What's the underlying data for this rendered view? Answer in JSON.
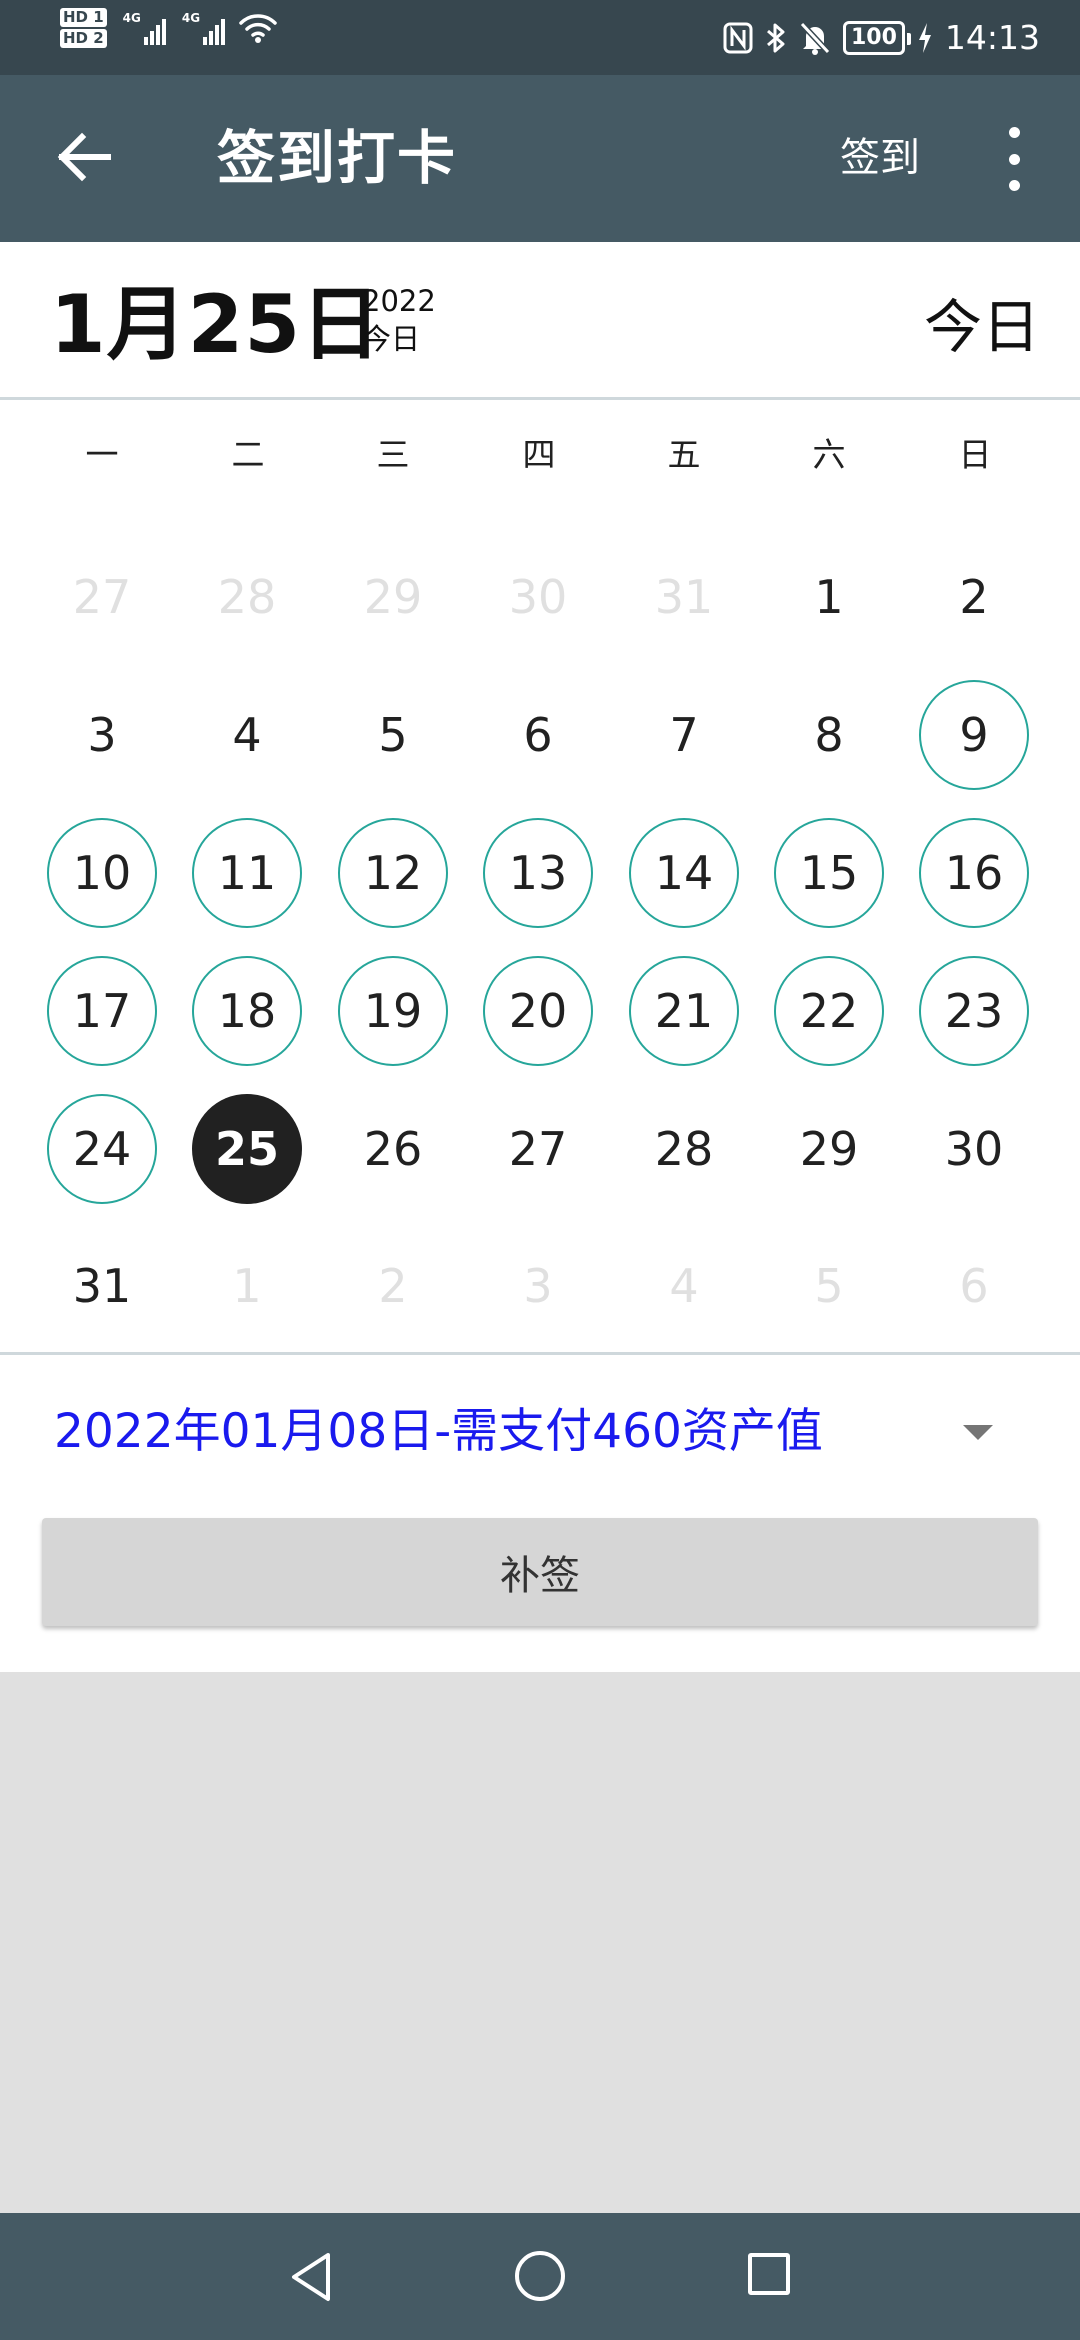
{
  "status_bar": {
    "time": "14:13",
    "battery": "100",
    "sim1_label": "HD 1",
    "sim2_label": "HD 2",
    "signal1_label": "4G",
    "signal2_label": "4G",
    "icons": [
      "nfc-icon",
      "bluetooth-icon",
      "mute-icon",
      "battery-icon",
      "charging-icon",
      "wifi-icon"
    ]
  },
  "app_bar": {
    "back_icon": "arrow-left-icon",
    "title": "签到打卡",
    "action_label": "签到",
    "more_icon": "more-vert-icon"
  },
  "date_header": {
    "selected_date": "1月25日",
    "year": "2022",
    "today_label": "今日",
    "today_button": "今日"
  },
  "weekdays": [
    "一",
    "二",
    "三",
    "四",
    "五",
    "六",
    "日"
  ],
  "calendar": {
    "weeks": [
      [
        {
          "n": "27",
          "s": "other"
        },
        {
          "n": "28",
          "s": "other"
        },
        {
          "n": "29",
          "s": "other"
        },
        {
          "n": "30",
          "s": "other"
        },
        {
          "n": "31",
          "s": "other"
        },
        {
          "n": "1",
          "s": "normal"
        },
        {
          "n": "2",
          "s": "normal"
        }
      ],
      [
        {
          "n": "3",
          "s": "normal"
        },
        {
          "n": "4",
          "s": "normal"
        },
        {
          "n": "5",
          "s": "normal"
        },
        {
          "n": "6",
          "s": "normal"
        },
        {
          "n": "7",
          "s": "normal"
        },
        {
          "n": "8",
          "s": "normal"
        },
        {
          "n": "9",
          "s": "signed"
        }
      ],
      [
        {
          "n": "10",
          "s": "signed"
        },
        {
          "n": "11",
          "s": "signed"
        },
        {
          "n": "12",
          "s": "signed"
        },
        {
          "n": "13",
          "s": "signed"
        },
        {
          "n": "14",
          "s": "signed"
        },
        {
          "n": "15",
          "s": "signed"
        },
        {
          "n": "16",
          "s": "signed"
        }
      ],
      [
        {
          "n": "17",
          "s": "signed"
        },
        {
          "n": "18",
          "s": "signed"
        },
        {
          "n": "19",
          "s": "signed"
        },
        {
          "n": "20",
          "s": "signed"
        },
        {
          "n": "21",
          "s": "signed"
        },
        {
          "n": "22",
          "s": "signed"
        },
        {
          "n": "23",
          "s": "signed"
        }
      ],
      [
        {
          "n": "24",
          "s": "signed"
        },
        {
          "n": "25",
          "s": "selected"
        },
        {
          "n": "26",
          "s": "normal"
        },
        {
          "n": "27",
          "s": "normal"
        },
        {
          "n": "28",
          "s": "normal"
        },
        {
          "n": "29",
          "s": "normal"
        },
        {
          "n": "30",
          "s": "normal"
        }
      ],
      [
        {
          "n": "31",
          "s": "normal"
        },
        {
          "n": "1",
          "s": "other"
        },
        {
          "n": "2",
          "s": "other"
        },
        {
          "n": "3",
          "s": "other"
        },
        {
          "n": "4",
          "s": "other"
        },
        {
          "n": "5",
          "s": "other"
        },
        {
          "n": "6",
          "s": "other"
        }
      ]
    ]
  },
  "makeup": {
    "selected_option": "2022年01月08日-需支付460资产值",
    "button_label": "补签"
  },
  "colors": {
    "app_bar": "#455a64",
    "status_bar": "#37474f",
    "signed_ring": "#26a69a",
    "selected_fill": "#212121",
    "option_text": "#1a1aee",
    "background": "#e0e0e0"
  },
  "nav_bar": {
    "icons": [
      "nav-back-icon",
      "nav-home-icon",
      "nav-recent-icon"
    ]
  }
}
